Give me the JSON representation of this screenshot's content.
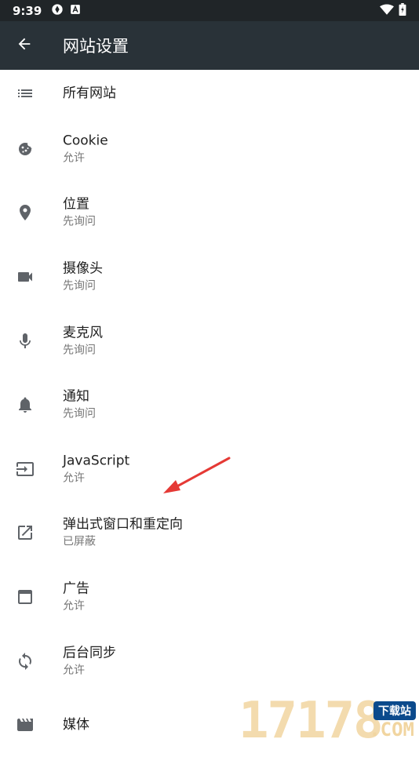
{
  "status_bar": {
    "time": "9:39"
  },
  "toolbar": {
    "title": "网站设置"
  },
  "list": {
    "items": [
      {
        "title": "所有网站",
        "subtitle": ""
      },
      {
        "title": "Cookie",
        "subtitle": "允许"
      },
      {
        "title": "位置",
        "subtitle": "先询问"
      },
      {
        "title": "摄像头",
        "subtitle": "先询问"
      },
      {
        "title": "麦克风",
        "subtitle": "先询问"
      },
      {
        "title": "通知",
        "subtitle": "先询问"
      },
      {
        "title": "JavaScript",
        "subtitle": "允许"
      },
      {
        "title": "弹出式窗口和重定向",
        "subtitle": "已屏蔽"
      },
      {
        "title": "广告",
        "subtitle": "允许"
      },
      {
        "title": "后台同步",
        "subtitle": "允许"
      },
      {
        "title": "媒体",
        "subtitle": ""
      }
    ]
  },
  "icons": {
    "back": "arrow-back-icon",
    "all_sites": "list-icon",
    "cookie": "cookie-icon",
    "location": "location-pin-icon",
    "camera": "videocam-icon",
    "mic": "mic-icon",
    "notifications": "bell-icon",
    "javascript": "input-icon",
    "popups": "open-in-new-icon",
    "ads": "window-icon",
    "sync": "sync-icon",
    "media": "movie-icon"
  },
  "colors": {
    "status_bar": "#202528",
    "toolbar": "#293238",
    "icon": "#5f6368",
    "title_text": "#212121",
    "subtitle_text": "#757575",
    "annotation": "#e53935"
  },
  "watermark": {
    "digits": "17178",
    "badge": "下载站",
    "domain": ".COM"
  }
}
